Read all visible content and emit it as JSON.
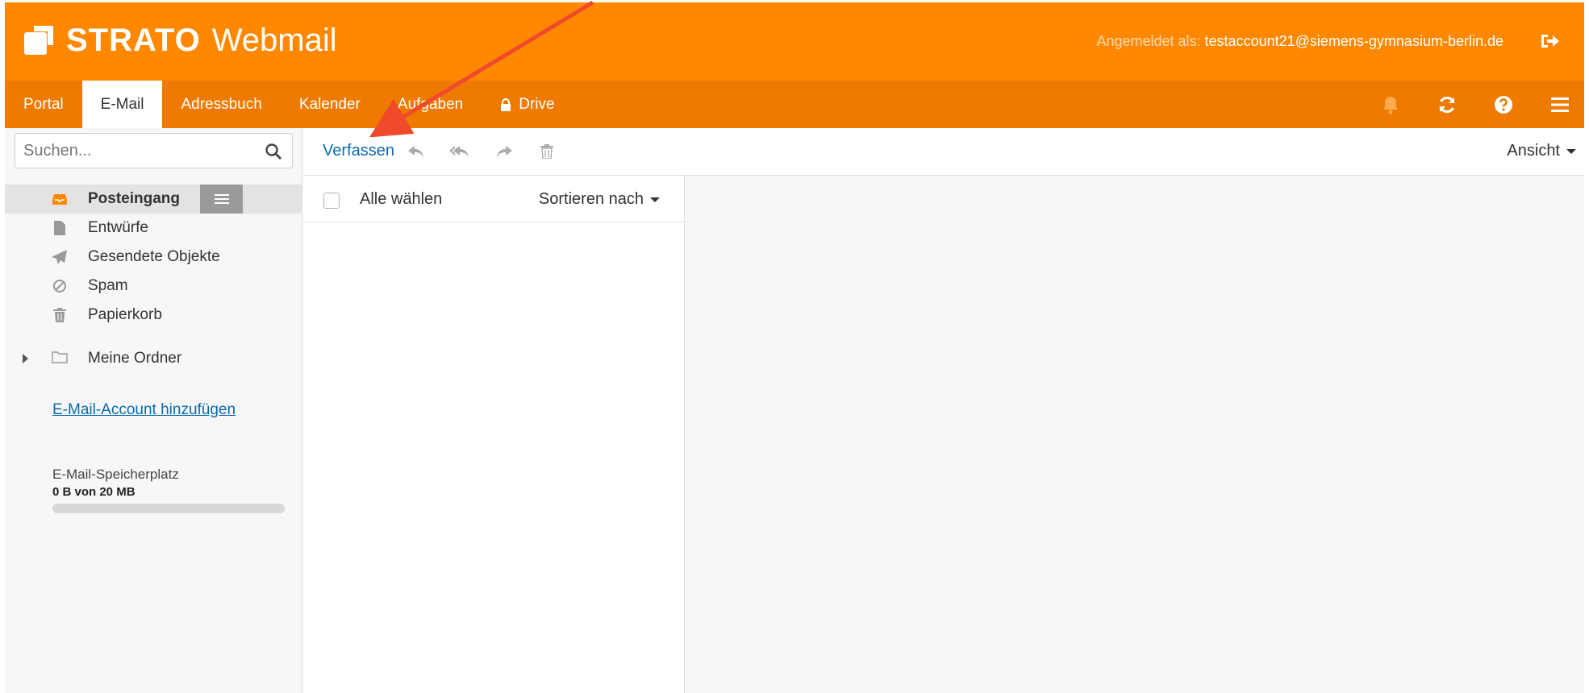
{
  "header": {
    "brand": "STRATO",
    "product": "Webmail",
    "login_label": "Angemeldet als:",
    "login_email": "testaccount21@siemens-gymnasium-berlin.de",
    "logout_icon": "sign-out-icon"
  },
  "nav": {
    "tabs": [
      {
        "label": "Portal",
        "active": false
      },
      {
        "label": "E-Mail",
        "active": true
      },
      {
        "label": "Adressbuch",
        "active": false
      },
      {
        "label": "Kalender",
        "active": false
      },
      {
        "label": "Aufgaben",
        "active": false
      },
      {
        "label": "Drive",
        "active": false,
        "icon": "lock-icon"
      }
    ],
    "right_icons": [
      "bell-icon",
      "refresh-icon",
      "help-icon",
      "menu-icon"
    ]
  },
  "sidebar": {
    "search_placeholder": "Suchen...",
    "folders": [
      {
        "label": "Posteingang",
        "icon": "inbox-icon",
        "selected": true
      },
      {
        "label": "Entwürfe",
        "icon": "file-icon",
        "selected": false
      },
      {
        "label": "Gesendete Objekte",
        "icon": "paper-plane-icon",
        "selected": false
      },
      {
        "label": "Spam",
        "icon": "ban-icon",
        "selected": false
      },
      {
        "label": "Papierkorb",
        "icon": "trash-icon",
        "selected": false
      }
    ],
    "my_folders": "Meine Ordner",
    "add_account": "E-Mail-Account hinzufügen",
    "quota": {
      "label": "E-Mail-Speicherplatz",
      "value": "0 B von 20 MB",
      "used_fraction": 0
    }
  },
  "toolbar": {
    "compose": "Verfassen",
    "actions": [
      "reply-icon",
      "reply-all-icon",
      "forward-icon",
      "delete-icon"
    ],
    "view": "Ansicht"
  },
  "mail_list": {
    "select_all": "Alle wählen",
    "sort": "Sortieren nach"
  },
  "colors": {
    "header_orange": "#ff8800",
    "nav_orange": "#ee7a00",
    "link_blue": "#0a6ab0",
    "annotation_red": "#f04a2c"
  }
}
